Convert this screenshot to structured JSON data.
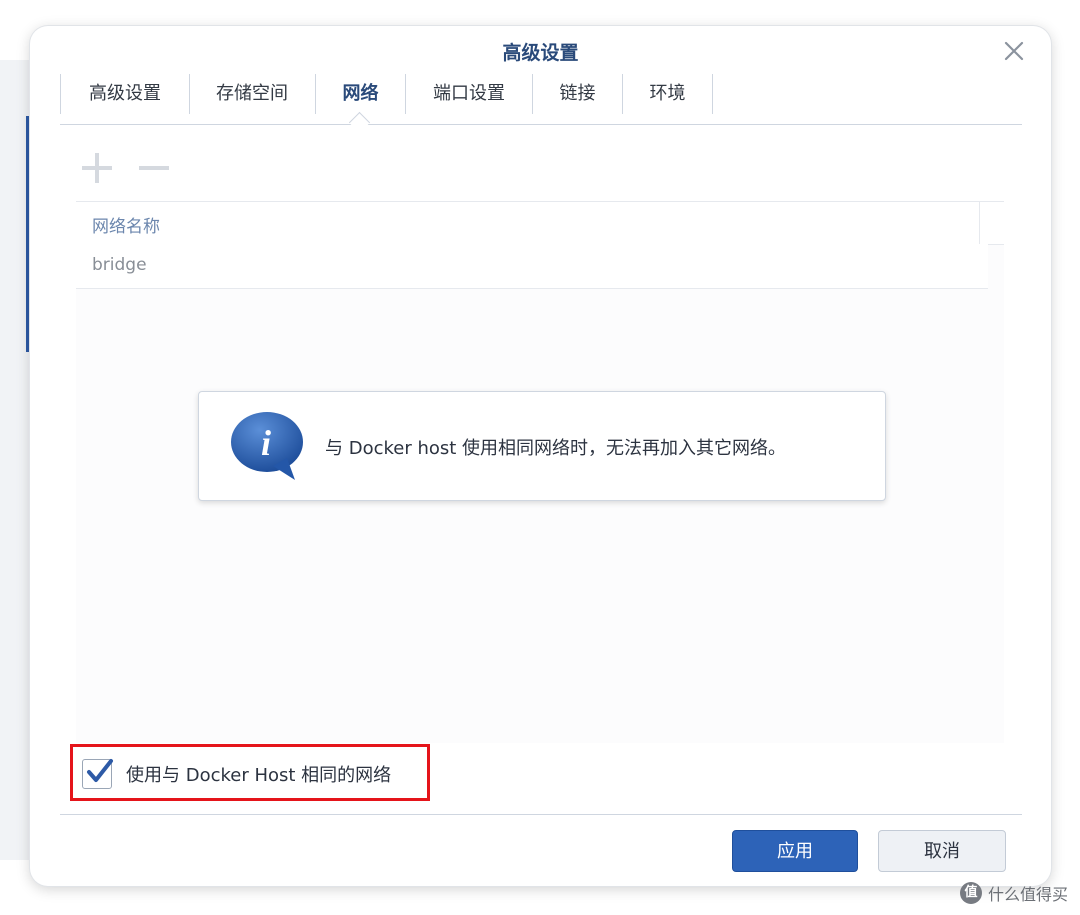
{
  "dialog": {
    "title": "高级设置",
    "close_icon": "close-icon"
  },
  "tabs": [
    {
      "label": "高级设置",
      "active": false
    },
    {
      "label": "存储空间",
      "active": false
    },
    {
      "label": "网络",
      "active": true
    },
    {
      "label": "端口设置",
      "active": false
    },
    {
      "label": "链接",
      "active": false
    },
    {
      "label": "环境",
      "active": false
    }
  ],
  "toolbar": {
    "add_icon": "plus-icon",
    "remove_icon": "minus-icon"
  },
  "network_table": {
    "column_header": "网络名称",
    "rows": [
      "bridge"
    ]
  },
  "info_message": {
    "icon": "info-speech-bubble-icon",
    "text": "与 Docker host 使用相同网络时，无法再加入其它网络。"
  },
  "use_host_network": {
    "label": "使用与 Docker Host 相同的网络",
    "checked": true
  },
  "footer": {
    "apply_label": "应用",
    "cancel_label": "取消"
  },
  "watermark": {
    "logo": "值",
    "text": "什么值得买"
  },
  "colors": {
    "accent": "#2d63b8",
    "title": "#2a4a7a",
    "highlight_border": "#e5141a"
  }
}
